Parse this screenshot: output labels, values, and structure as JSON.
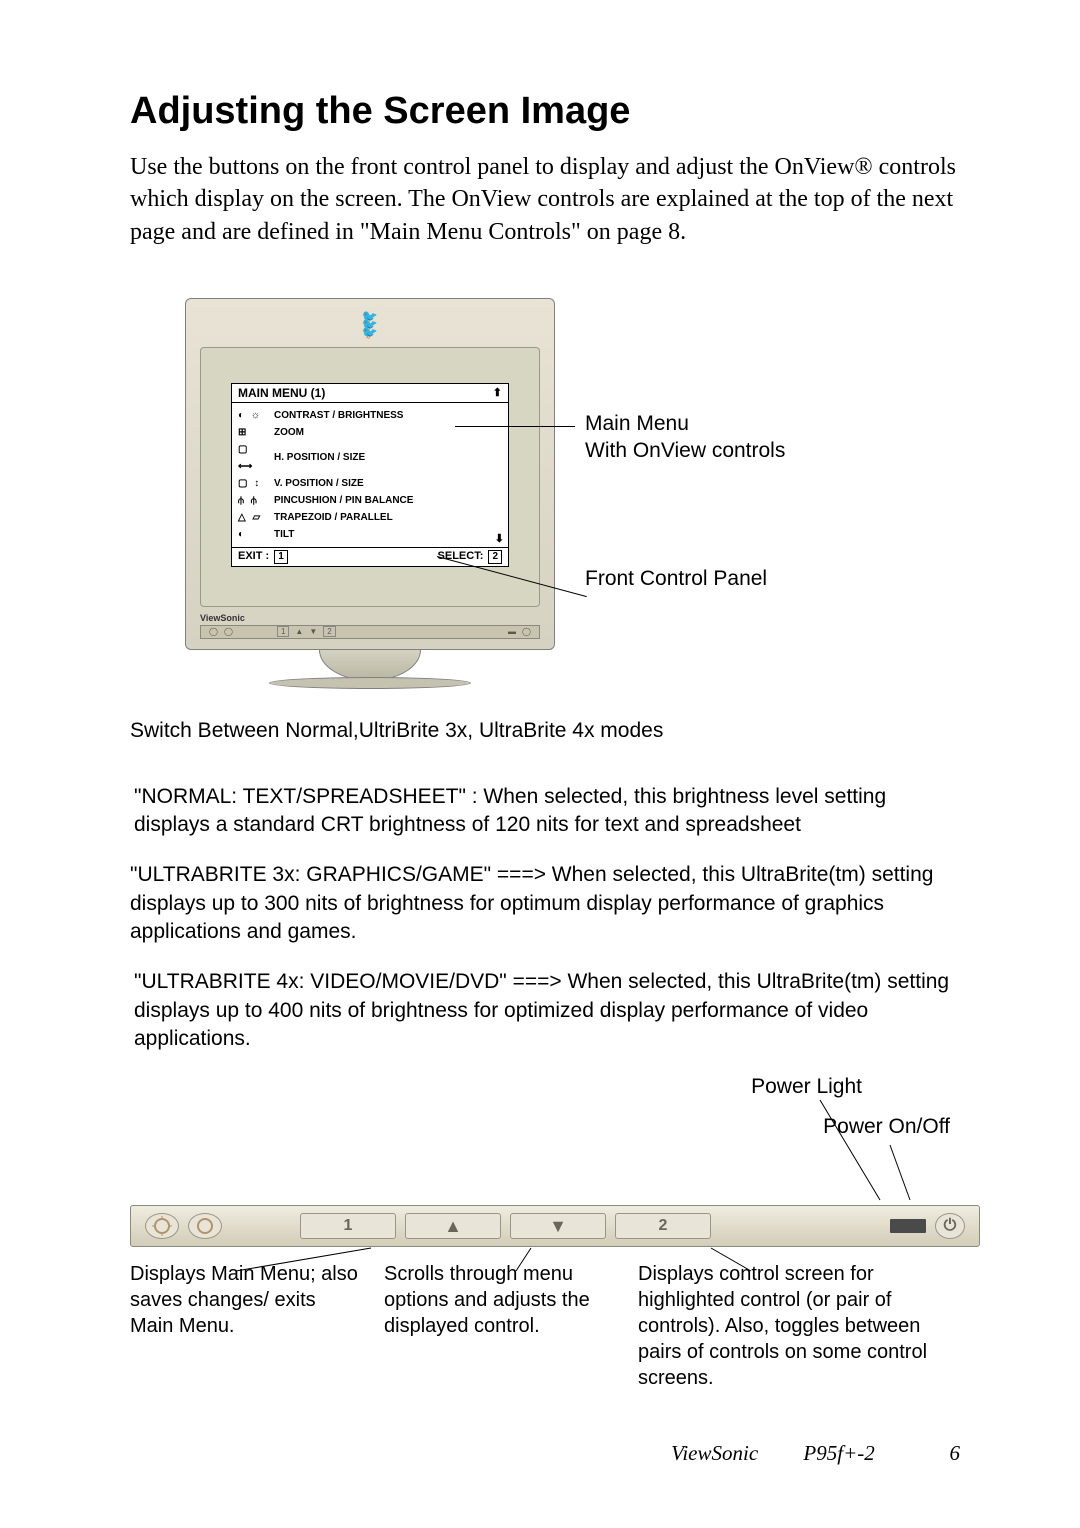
{
  "title": "Adjusting the Screen Image",
  "intro": "Use the buttons on the front control panel to display and adjust the OnView® controls which display on the screen. The OnView controls are explained at the top of the next page and are defined in \"Main Menu Controls\" on page  8.",
  "osd": {
    "title": "MAIN MENU (1)",
    "items": [
      {
        "icons": "◐ ☼",
        "label": "CONTRAST / BRIGHTNESS"
      },
      {
        "icons": "⊞",
        "label": "ZOOM"
      },
      {
        "icons": "▢ ⟷",
        "label": "H. POSITION / SIZE"
      },
      {
        "icons": "▢ ↕",
        "label": "V. POSITION / SIZE"
      },
      {
        "icons": "⫛ ⫛",
        "label": "PINCUSHION / PIN BALANCE"
      },
      {
        "icons": "△ ▱",
        "label": "TRAPEZOID / PARALLEL"
      },
      {
        "icons": "◐",
        "label": "TILT"
      }
    ],
    "exit": "EXIT :",
    "exit_key": "1",
    "select": "SELECT:",
    "select_key": "2"
  },
  "brand": "ViewSonic",
  "side": {
    "main_menu": "Main Menu",
    "onview": "With OnView controls",
    "front_panel": "Front Control Panel"
  },
  "switch_line": "Switch Between Normal,UltriBrite 3x, UltraBrite 4x modes",
  "modes": {
    "normal": "\"NORMAL: TEXT/SPREADSHEET\" : When selected, this brightness level setting displays a standard CRT brightness of 120 nits for text and spreadsheet",
    "ub3x": "\"ULTRABRITE 3x: GRAPHICS/GAME\"  ===> When selected, this UltraBrite(tm) setting displays up to 300 nits of brightness for optimum display performance of graphics applications and games.",
    "ub4x": "\"ULTRABRITE 4x: VIDEO/MOVIE/DVD\" ===> When selected, this UltraBrite(tm) setting displays up to 400 nits of brightness for optimized display performance of video applications."
  },
  "power_light": "Power Light",
  "power_onoff": "Power On/Off",
  "panel": {
    "btn1": "1",
    "up": "▲",
    "down": "▼",
    "btn2": "2",
    "pwr": "⏻"
  },
  "callouts": {
    "c1": "Displays Main Menu; also saves changes/ exits Main Menu.",
    "c2": "Scrolls through menu options and adjusts the displayed control.",
    "c3": "Displays control screen for highlighted control (or pair of controls). Also, toggles between pairs of controls on some control screens."
  },
  "footer": {
    "brand": "ViewSonic",
    "model": "P95f+-2",
    "page": "6"
  }
}
